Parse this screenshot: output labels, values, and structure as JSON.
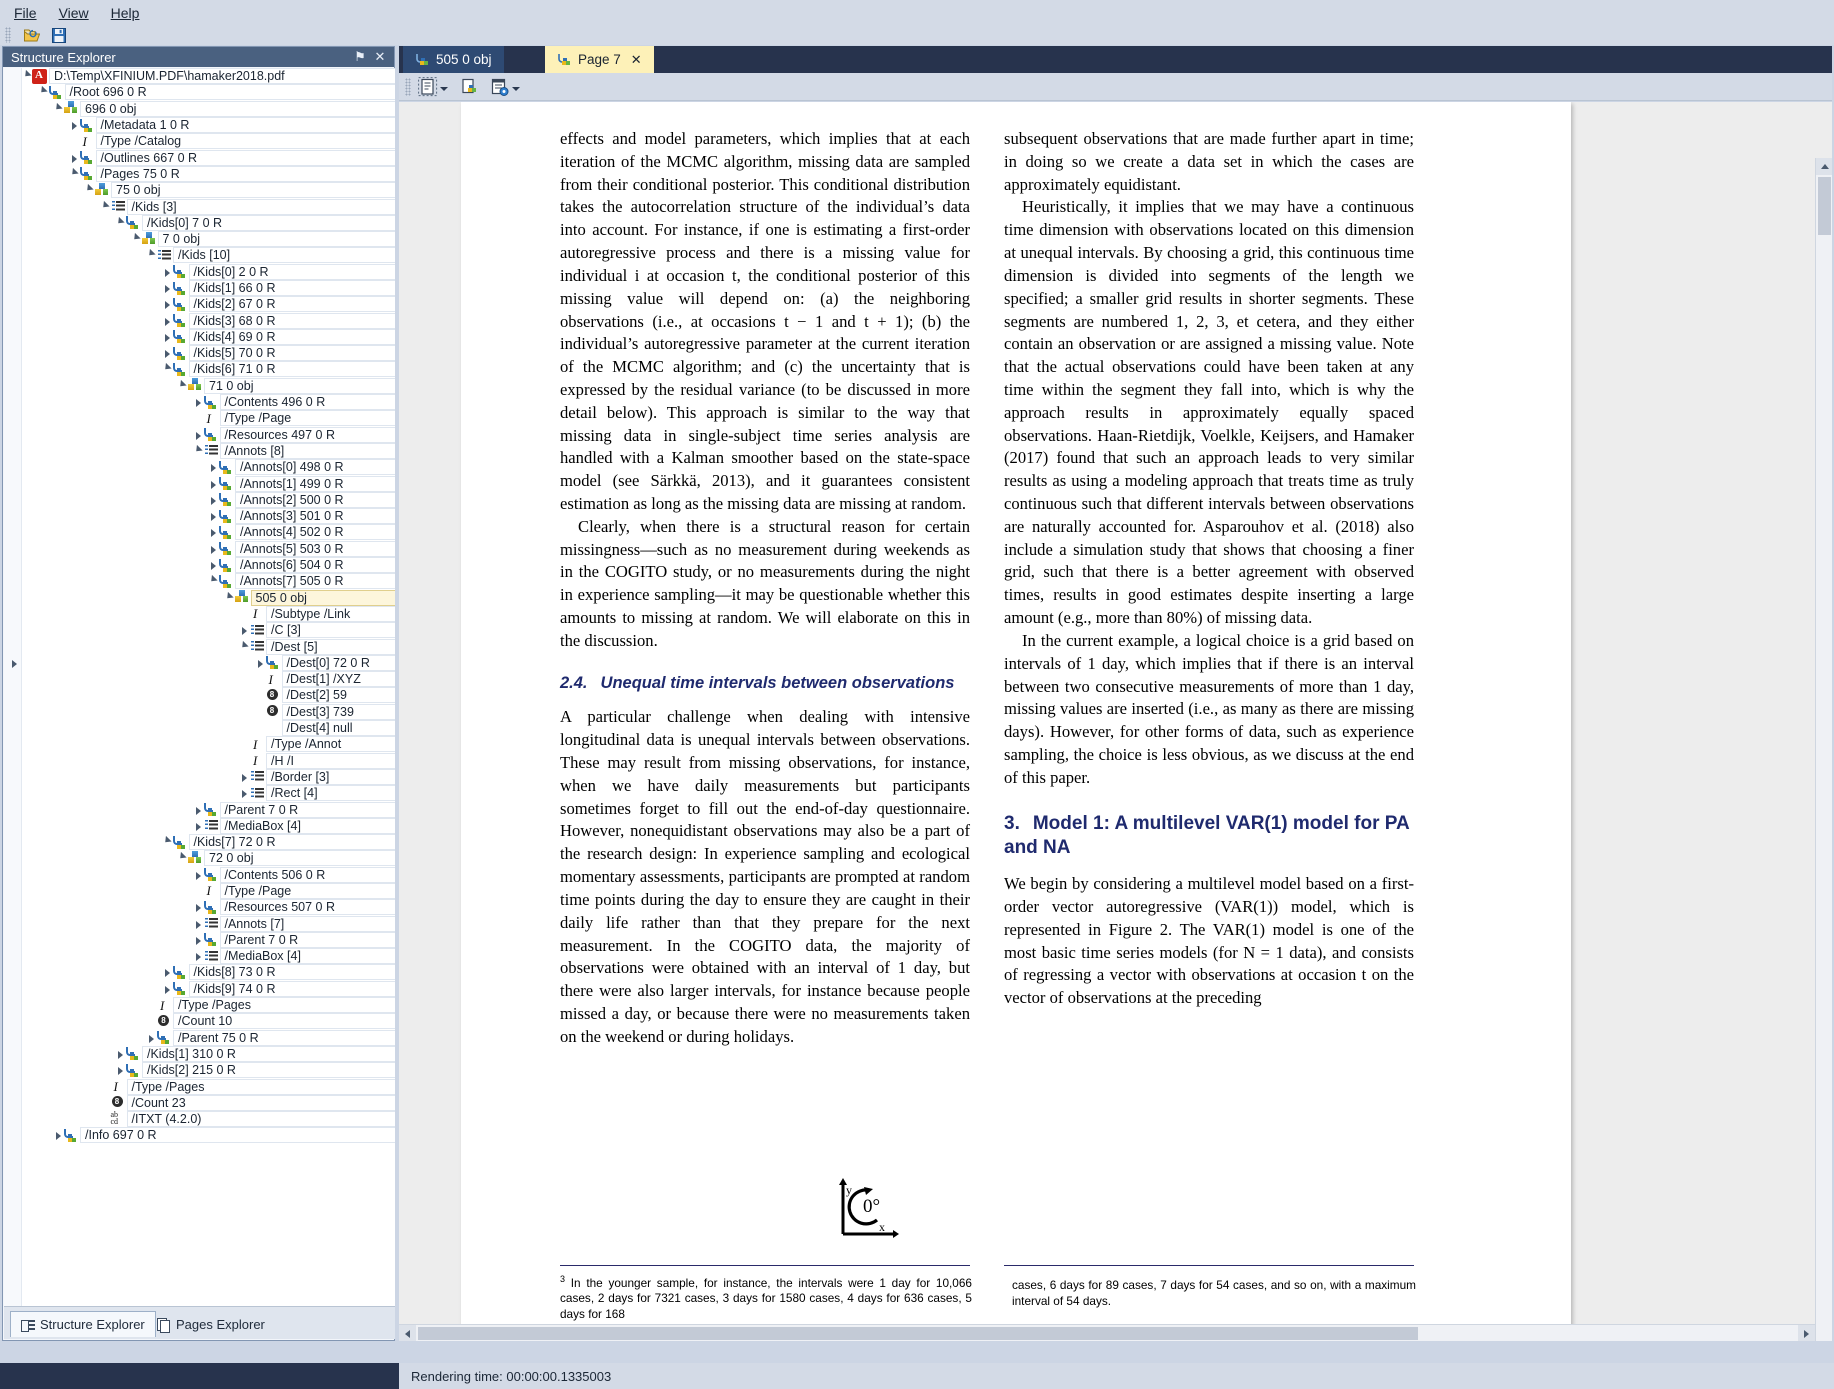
{
  "menu": {
    "items": [
      "File",
      "View",
      "Help"
    ]
  },
  "toolbar": {
    "open_label": "Open",
    "save_label": "Save"
  },
  "left_panel": {
    "caption": "Structure Explorer",
    "pin_label": "⚑",
    "close_label": "✕",
    "tabs": [
      {
        "label": "Structure Explorer",
        "icon": "structure-icon",
        "active": true
      },
      {
        "label": "Pages Explorer",
        "icon": "pages-icon",
        "active": false
      }
    ],
    "tree": [
      {
        "indent": 1,
        "twig": "expanded",
        "icon": "pdf-icon",
        "label": "D:\\Temp\\XFINIUM.PDF\\hamaker2018.pdf"
      },
      {
        "indent": 2,
        "twig": "expanded",
        "icon": "ref-icon",
        "label": "/Root 696 0 R"
      },
      {
        "indent": 3,
        "twig": "expanded",
        "icon": "obj-icon",
        "label": "696 0 obj"
      },
      {
        "indent": 4,
        "twig": "collapsed",
        "icon": "ref-icon",
        "label": "/Metadata 1 0 R"
      },
      {
        "indent": 4,
        "twig": "none",
        "icon": "name-icon",
        "label": "/Type /Catalog"
      },
      {
        "indent": 4,
        "twig": "collapsed",
        "icon": "ref-icon",
        "label": "/Outlines 667 0 R"
      },
      {
        "indent": 4,
        "twig": "expanded",
        "icon": "ref-icon",
        "label": "/Pages 75 0 R"
      },
      {
        "indent": 5,
        "twig": "expanded",
        "icon": "obj-icon",
        "label": "75 0 obj"
      },
      {
        "indent": 6,
        "twig": "expanded",
        "icon": "array-icon",
        "label": "/Kids [3]"
      },
      {
        "indent": 7,
        "twig": "expanded",
        "icon": "ref-icon",
        "label": "/Kids[0] 7 0 R"
      },
      {
        "indent": 8,
        "twig": "expanded",
        "icon": "obj-icon",
        "label": "7 0 obj"
      },
      {
        "indent": 9,
        "twig": "expanded",
        "icon": "array-icon",
        "label": "/Kids [10]"
      },
      {
        "indent": 10,
        "twig": "collapsed",
        "icon": "ref-icon",
        "label": "/Kids[0] 2 0 R"
      },
      {
        "indent": 10,
        "twig": "collapsed",
        "icon": "ref-icon",
        "label": "/Kids[1] 66 0 R"
      },
      {
        "indent": 10,
        "twig": "collapsed",
        "icon": "ref-icon",
        "label": "/Kids[2] 67 0 R"
      },
      {
        "indent": 10,
        "twig": "collapsed",
        "icon": "ref-icon",
        "label": "/Kids[3] 68 0 R"
      },
      {
        "indent": 10,
        "twig": "collapsed",
        "icon": "ref-icon",
        "label": "/Kids[4] 69 0 R"
      },
      {
        "indent": 10,
        "twig": "collapsed",
        "icon": "ref-icon",
        "label": "/Kids[5] 70 0 R"
      },
      {
        "indent": 10,
        "twig": "expanded",
        "icon": "ref-icon",
        "label": "/Kids[6] 71 0 R"
      },
      {
        "indent": 11,
        "twig": "expanded",
        "icon": "obj-icon",
        "label": "71 0 obj"
      },
      {
        "indent": 12,
        "twig": "collapsed",
        "icon": "ref-icon",
        "label": "/Contents 496 0 R"
      },
      {
        "indent": 12,
        "twig": "none",
        "icon": "name-icon",
        "label": "/Type /Page"
      },
      {
        "indent": 12,
        "twig": "collapsed",
        "icon": "ref-icon",
        "label": "/Resources 497 0 R"
      },
      {
        "indent": 12,
        "twig": "expanded",
        "icon": "array-icon",
        "label": "/Annots [8]"
      },
      {
        "indent": 13,
        "twig": "collapsed",
        "icon": "ref-icon",
        "label": "/Annots[0] 498 0 R"
      },
      {
        "indent": 13,
        "twig": "collapsed",
        "icon": "ref-icon",
        "label": "/Annots[1] 499 0 R"
      },
      {
        "indent": 13,
        "twig": "collapsed",
        "icon": "ref-icon",
        "label": "/Annots[2] 500 0 R"
      },
      {
        "indent": 13,
        "twig": "collapsed",
        "icon": "ref-icon",
        "label": "/Annots[3] 501 0 R"
      },
      {
        "indent": 13,
        "twig": "collapsed",
        "icon": "ref-icon",
        "label": "/Annots[4] 502 0 R"
      },
      {
        "indent": 13,
        "twig": "collapsed",
        "icon": "ref-icon",
        "label": "/Annots[5] 503 0 R"
      },
      {
        "indent": 13,
        "twig": "collapsed",
        "icon": "ref-icon",
        "label": "/Annots[6] 504 0 R"
      },
      {
        "indent": 13,
        "twig": "expanded",
        "icon": "ref-icon",
        "label": "/Annots[7] 505 0 R"
      },
      {
        "indent": 14,
        "twig": "expanded",
        "icon": "obj-icon",
        "label": "505 0 obj",
        "selected": true
      },
      {
        "indent": 15,
        "twig": "none",
        "icon": "name-icon",
        "label": "/Subtype /Link"
      },
      {
        "indent": 15,
        "twig": "collapsed",
        "icon": "array-icon",
        "label": "/C [3]"
      },
      {
        "indent": 15,
        "twig": "expanded",
        "icon": "array-icon",
        "label": "/Dest [5]"
      },
      {
        "indent": 16,
        "twig": "collapsed",
        "icon": "ref-icon",
        "label": "/Dest[0] 72 0 R"
      },
      {
        "indent": 16,
        "twig": "none",
        "icon": "name-icon",
        "label": "/Dest[1] /XYZ"
      },
      {
        "indent": 16,
        "twig": "none",
        "icon": "number-icon",
        "label": "/Dest[2] 59"
      },
      {
        "indent": 16,
        "twig": "none",
        "icon": "number-icon",
        "label": "/Dest[3] 739"
      },
      {
        "indent": 16,
        "twig": "none",
        "icon": "none",
        "label": "/Dest[4] null"
      },
      {
        "indent": 15,
        "twig": "none",
        "icon": "name-icon",
        "label": "/Type /Annot"
      },
      {
        "indent": 15,
        "twig": "none",
        "icon": "name-icon",
        "label": "/H /I"
      },
      {
        "indent": 15,
        "twig": "collapsed",
        "icon": "array-icon",
        "label": "/Border [3]"
      },
      {
        "indent": 15,
        "twig": "collapsed",
        "icon": "array-icon",
        "label": "/Rect [4]"
      },
      {
        "indent": 12,
        "twig": "collapsed",
        "icon": "ref-icon",
        "label": "/Parent 7 0 R"
      },
      {
        "indent": 12,
        "twig": "collapsed",
        "icon": "array-icon",
        "label": "/MediaBox [4]"
      },
      {
        "indent": 10,
        "twig": "expanded",
        "icon": "ref-icon",
        "label": "/Kids[7] 72 0 R"
      },
      {
        "indent": 11,
        "twig": "expanded",
        "icon": "obj-icon",
        "label": "72 0 obj"
      },
      {
        "indent": 12,
        "twig": "collapsed",
        "icon": "ref-icon",
        "label": "/Contents 506 0 R"
      },
      {
        "indent": 12,
        "twig": "none",
        "icon": "name-icon",
        "label": "/Type /Page"
      },
      {
        "indent": 12,
        "twig": "collapsed",
        "icon": "ref-icon",
        "label": "/Resources 507 0 R"
      },
      {
        "indent": 12,
        "twig": "collapsed",
        "icon": "array-icon",
        "label": "/Annots [7]"
      },
      {
        "indent": 12,
        "twig": "collapsed",
        "icon": "ref-icon",
        "label": "/Parent 7 0 R"
      },
      {
        "indent": 12,
        "twig": "collapsed",
        "icon": "array-icon",
        "label": "/MediaBox [4]"
      },
      {
        "indent": 10,
        "twig": "collapsed",
        "icon": "ref-icon",
        "label": "/Kids[8] 73 0 R"
      },
      {
        "indent": 10,
        "twig": "collapsed",
        "icon": "ref-icon",
        "label": "/Kids[9] 74 0 R"
      },
      {
        "indent": 9,
        "twig": "none",
        "icon": "name-icon",
        "label": "/Type /Pages"
      },
      {
        "indent": 9,
        "twig": "none",
        "icon": "number-icon",
        "label": "/Count 10"
      },
      {
        "indent": 9,
        "twig": "collapsed",
        "icon": "ref-icon",
        "label": "/Parent 75 0 R"
      },
      {
        "indent": 7,
        "twig": "collapsed",
        "icon": "ref-icon",
        "label": "/Kids[1] 310 0 R"
      },
      {
        "indent": 7,
        "twig": "collapsed",
        "icon": "ref-icon",
        "label": "/Kids[2] 215 0 R"
      },
      {
        "indent": 6,
        "twig": "none",
        "icon": "name-icon",
        "label": "/Type /Pages"
      },
      {
        "indent": 6,
        "twig": "none",
        "icon": "number-icon",
        "label": "/Count 23"
      },
      {
        "indent": 6,
        "twig": "none",
        "icon": "string-icon",
        "label": "/ITXT (4.2.0)"
      },
      {
        "indent": 3,
        "twig": "collapsed",
        "icon": "ref-icon",
        "label": "/Info 697 0 R"
      }
    ]
  },
  "document_tabs": [
    {
      "label": "505 0 obj",
      "active": false,
      "closable": false
    },
    {
      "label": "Page 7",
      "active": true,
      "closable": true,
      "close_label": "✕"
    }
  ],
  "view_toolbar": {
    "buttons": [
      {
        "name": "select-text-tool",
        "has_caret": true
      },
      {
        "name": "select-object-tool",
        "has_caret": false
      },
      {
        "name": "page-properties-tool",
        "has_caret": true
      }
    ]
  },
  "page_view": {
    "rotation_label": "0°",
    "axis_y_label": "y",
    "axis_x_label": "x",
    "left_column": {
      "paragraphs": [
        "effects and model parameters, which implies that at each iteration of the MCMC algorithm, missing data are sampled from their conditional posterior. This conditional distribution takes the autocorrelation structure of the individual’s data into account. For instance, if one is estimating a first-order autoregressive process and there is a missing value for individual i at occasion t, the conditional posterior of this missing value will depend on: (a) the neighboring observations (i.e., at occasions t − 1 and t + 1); (b) the individual’s autoregressive parameter at the current iteration of the MCMC algorithm; and (c) the uncertainty that is expressed by the residual variance (to be discussed in more detail below). This approach is similar to the way that missing data in single-subject time series analysis are handled with a Kalman smoother based on the state-space model (see Särkkä, 2013), and it guarantees consistent estimation as long as the missing data are missing at random.",
        "Clearly, when there is a structural reason for certain missingness—such as no measurement during weekends as in the COGITO study, or no measurements during the night in experience sampling—it may be questionable whether this amounts to missing at random. We will elaborate on this in the discussion."
      ],
      "section_heading": {
        "number": "2.4.",
        "title": "Unequal time intervals between observations"
      },
      "after_heading": "A particular challenge when dealing with intensive longitudinal data is unequal intervals between observations. These may result from missing observations, for instance, when we have daily measurements but participants sometimes forget to fill out the end-of-day questionnaire. However, nonequidistant observations may also be a part of the research design: In experience sampling and ecological momentary assessments, participants are prompted at random time points during the day to ensure they are caught in their daily life rather than that they prepare for the next measurement. In the COGITO data, the majority of observations were obtained with an interval of 1 day, but there were also larger intervals, for instance because people missed a day, or because there were no measurements taken on the weekend or during holidays.",
      "footnote_marker": "3",
      "footnote": "In the younger sample, for instance, the intervals were 1 day for 10,066 cases, 2 days for 7321 cases, 3 days for 1580 cases, 4 days for 636 cases, 5 days for 168"
    },
    "right_column": {
      "paragraphs_top": [
        "subsequent observations that are made further apart in time; in doing so we create a data set in which the cases are approximately equidistant.",
        "Heuristically, it implies that we may have a continuous time dimension with observations located on this dimension at unequal intervals. By choosing a grid, this continuous time dimension is divided into segments of the length we specified; a smaller grid results in shorter segments. These segments are numbered 1, 2, 3, et cetera, and they either contain an observation or are assigned a missing value. Note that the actual observations could have been taken at any time within the segment they fall into, which is why the approach results in approximately equally spaced observations. Haan-Rietdijk, Voelkle, Keijsers, and Hamaker (2017) found that such an approach leads to very similar results as using a modeling approach that treats time as truly continuous such that different intervals between observations are naturally accounted for. Asparouhov et al. (2018) also include a simulation study that shows that choosing a finer grid, such that there is a better agreement with observed times, results in good estimates despite inserting a large amount (e.g., more than 80%) of missing data.",
        "In the current example, a logical choice is a grid based on intervals of 1 day, which implies that if there is an interval between two consecutive measurements of more than 1 day, missing values are inserted (i.e., as many as there are missing days). However, for other forms of data, such as experience sampling, the choice is less obvious, as we discuss at the end of this paper."
      ],
      "section_heading": {
        "number": "3.",
        "title": "Model 1: A multilevel VAR(1) model for PA and NA"
      },
      "after_heading": "We begin by considering a multilevel model based on a first-order vector autoregressive (VAR(1)) model, which is represented in Figure 2. The VAR(1) model is one of the most basic time series models (for N = 1 data), and consists of regressing a vector with observations at occasion t on the vector of observations at the preceding",
      "footnote": "cases, 6 days for 89 cases, 7 days for 54 cases, and so on, with a maximum interval of 54 days.",
      "links": [
        "2017",
        "2018",
        "2013",
        "Figure 2"
      ]
    }
  },
  "status_bar": {
    "text": "Rendering time: 00:00:00.1335003"
  }
}
